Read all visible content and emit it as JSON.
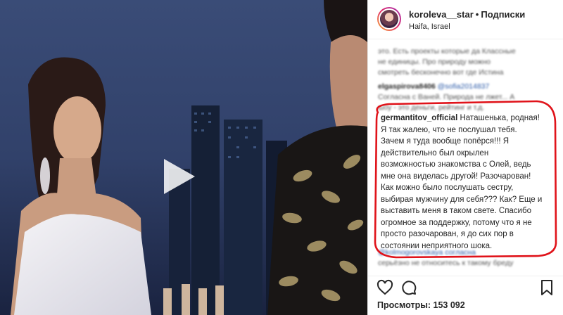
{
  "post": {
    "username": "koroleva__star",
    "separator": "•",
    "follow_label": "Подписки",
    "location": "Haifa, Israel"
  },
  "blurred_comments": [
    {
      "text": "это. Есть проекты которые да Классные"
    },
    {
      "text": "не единицы. Про природу можно"
    },
    {
      "text": "смотреть бесконечно вот где Истина"
    },
    {
      "user": "elgaspirova8406",
      "text": "@sofia2014837"
    },
    {
      "text": "Согласна с Ваней. Природа не лжет... А"
    },
    {
      "text": "шоу - это деньги, рейтинг и т.д."
    }
  ],
  "highlighted_comment": {
    "username": "germantitov_official",
    "lines": [
      "Наташенька, родная!",
      "Я так жалею, что не послушал тебя.",
      "Зачем я туда вообще попёрся!!! Я",
      "действительно был окрылен",
      "возможностью знакомства с Олей, ведь",
      "мне она виделась другой! Разочарован!",
      "Как можно было послушать сестру,",
      "выбирая мужчину для себя??? Как? Еще и",
      "выставить меня в таком свете. Спасибо",
      "огромное за поддержку, потому что я не",
      "просто разочарован, я до сих пор в",
      "состоянии неприятного шока."
    ]
  },
  "blurred_after": [
    {
      "user": "",
      "text": "@kolmogorovskaya согласна"
    },
    {
      "text": "серьёзно не относитесь к такому бреду"
    }
  ],
  "actions": {
    "like_icon": "heart-icon",
    "comment_icon": "comment-icon",
    "share_icon": "share-icon",
    "save_icon": "bookmark-icon"
  },
  "views": {
    "label": "Просмотры:",
    "count": "153 092"
  },
  "colors": {
    "highlight_ring": "#e0131a",
    "text": "#262626"
  }
}
